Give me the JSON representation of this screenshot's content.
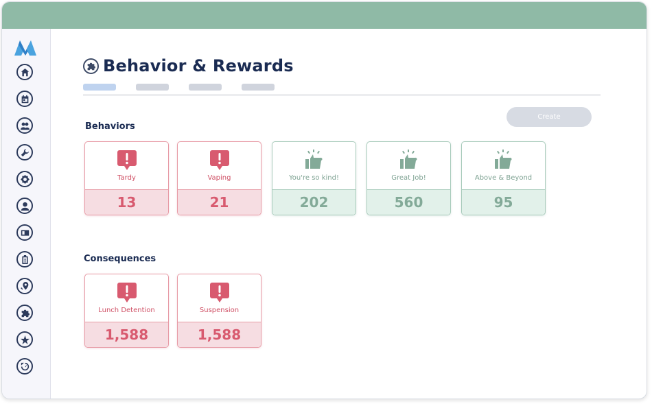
{
  "app": {
    "title": "Behavior & Rewards"
  },
  "colors": {
    "topbar": "#8fbaa6",
    "negative": "#d85a6f",
    "positive": "#83aa98",
    "title": "#1a2b52"
  },
  "sidebar": {
    "items": [
      {
        "name": "home-icon"
      },
      {
        "name": "calendar-icon"
      },
      {
        "name": "users-icon"
      },
      {
        "name": "wrench-icon"
      },
      {
        "name": "settings-icon"
      },
      {
        "name": "user-icon"
      },
      {
        "name": "id-card-icon"
      },
      {
        "name": "clipboard-icon"
      },
      {
        "name": "location-check-icon"
      },
      {
        "name": "puzzle-icon"
      },
      {
        "name": "star-icon"
      },
      {
        "name": "speed-icon"
      }
    ]
  },
  "header": {
    "title": "Behavior & Rewards",
    "tabs": [
      {
        "state": "active"
      },
      {
        "state": "inactive"
      },
      {
        "state": "inactive"
      },
      {
        "state": "inactive"
      }
    ]
  },
  "toolbar": {
    "create_label": "Create"
  },
  "behaviors": {
    "title": "Behaviors",
    "cards": [
      {
        "label": "Tardy",
        "count": "13",
        "kind": "negative",
        "icon": "alert-icon"
      },
      {
        "label": "Vaping",
        "count": "21",
        "kind": "negative",
        "icon": "alert-icon"
      },
      {
        "label": "You're so kind!",
        "count": "202",
        "kind": "positive",
        "icon": "thumbs-up-icon"
      },
      {
        "label": "Great Job!",
        "count": "560",
        "kind": "positive",
        "icon": "thumbs-up-icon"
      },
      {
        "label": "Above & Beyond",
        "count": "95",
        "kind": "positive",
        "icon": "thumbs-up-icon"
      }
    ]
  },
  "consequences": {
    "title": "Consequences",
    "cards": [
      {
        "label": "Lunch Detention",
        "count": "1,588",
        "kind": "negative",
        "icon": "alert-icon"
      },
      {
        "label": "Suspension",
        "count": "1,588",
        "kind": "negative",
        "icon": "alert-icon"
      }
    ]
  }
}
